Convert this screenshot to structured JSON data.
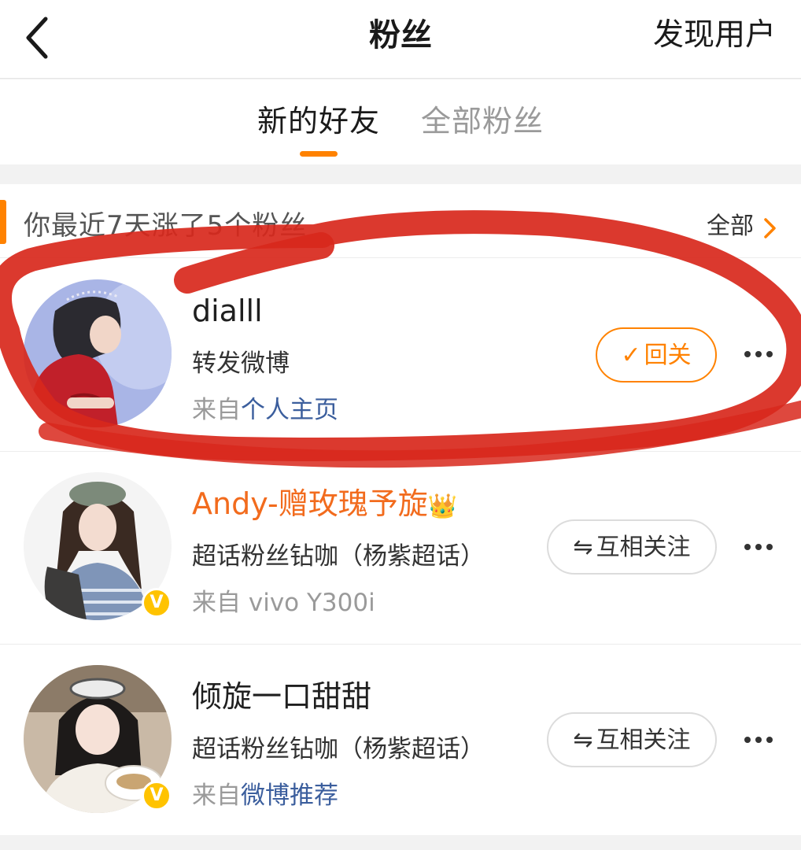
{
  "nav": {
    "title": "粉丝",
    "action_label": "发现用户",
    "back_icon": "chevron-left-icon"
  },
  "tabs": [
    {
      "label": "新的好友",
      "active": true
    },
    {
      "label": "全部粉丝",
      "active": false
    }
  ],
  "section": {
    "title": "你最近7天涨了5个粉丝",
    "all_label": "全部",
    "accent_color": "#ff8200"
  },
  "fans": [
    {
      "name": "dialll",
      "desc": "转发微博",
      "source_prefix": "来自",
      "source_value": "个人主页",
      "button_icon": "✓",
      "button_label": "回关",
      "verified": false
    },
    {
      "name": "Andy-赠玫瑰予旋",
      "name_emoji": "👑",
      "desc": "超话粉丝钻咖（杨紫超话）",
      "source_prefix": "来自 ",
      "source_value": "vivo Y300i",
      "button_icon": "⇋",
      "button_label": "互相关注",
      "verified": true,
      "verified_mark": "V"
    },
    {
      "name": "倾旋一口甜甜",
      "desc": "超话粉丝钻咖（杨紫超话）",
      "source_prefix": "来自",
      "source_value": "微博推荐",
      "button_icon": "⇋",
      "button_label": "互相关注",
      "verified": true,
      "verified_mark": "V"
    }
  ],
  "colors": {
    "brand_orange": "#ff8200",
    "vip_name": "#f26b1d",
    "link_blue": "#3b5e9d",
    "annotation_red": "#d8281c"
  }
}
